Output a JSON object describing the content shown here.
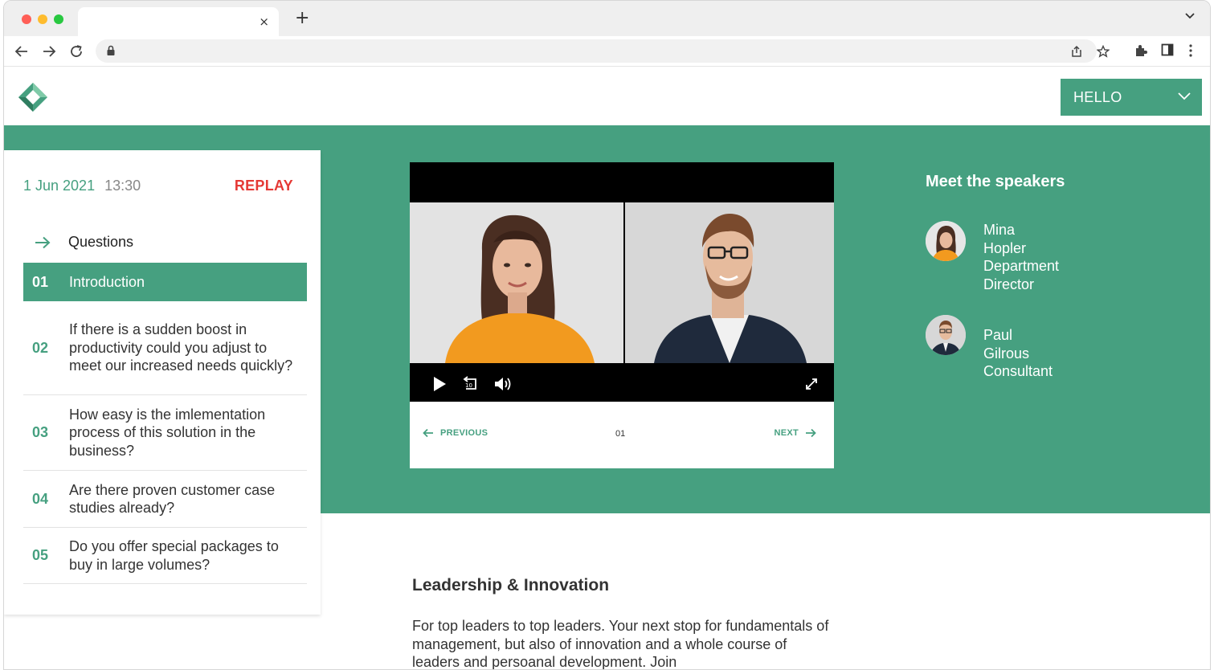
{
  "browser": {
    "tab_close": "×",
    "new_tab": "+",
    "dot_colors": [
      "#ff5f57",
      "#febc2e",
      "#28c840"
    ]
  },
  "header": {
    "menu_label": "HELLO",
    "accent_color": "#46a080"
  },
  "session": {
    "date": "1 Jun 2021",
    "time": "13:30",
    "replay_label": "REPLAY"
  },
  "questions": {
    "heading": "Questions",
    "items": [
      {
        "num": "01",
        "text": "Introduction"
      },
      {
        "num": "02",
        "text": "If there is a sudden boost in productivity could you adjust to meet our increased needs quickly?"
      },
      {
        "num": "03",
        "text": "How easy is the imlementation process of this solution in the business?"
      },
      {
        "num": "04",
        "text": "Are there proven customer case studies already?"
      },
      {
        "num": "05",
        "text": "Do you offer special packages to buy in large volumes?"
      }
    ]
  },
  "player": {
    "prev_label": "PREVIOUS",
    "next_label": "NEXT",
    "page": "01",
    "replay_badge": "10"
  },
  "speakers": {
    "title": "Meet the speakers",
    "list": [
      {
        "first": "Mina",
        "last": "Hopler",
        "role_1": "Department",
        "role_2": "Director"
      },
      {
        "first": "Paul",
        "last": "Gilrous",
        "role_1": "Consultant",
        "role_2": ""
      }
    ]
  },
  "article": {
    "title": "Leadership & Innovation",
    "body": "For top leaders to top leaders. Your next stop for fundamentals of management, but also of innovation and a whole course of leaders and persoanal development. Join"
  }
}
